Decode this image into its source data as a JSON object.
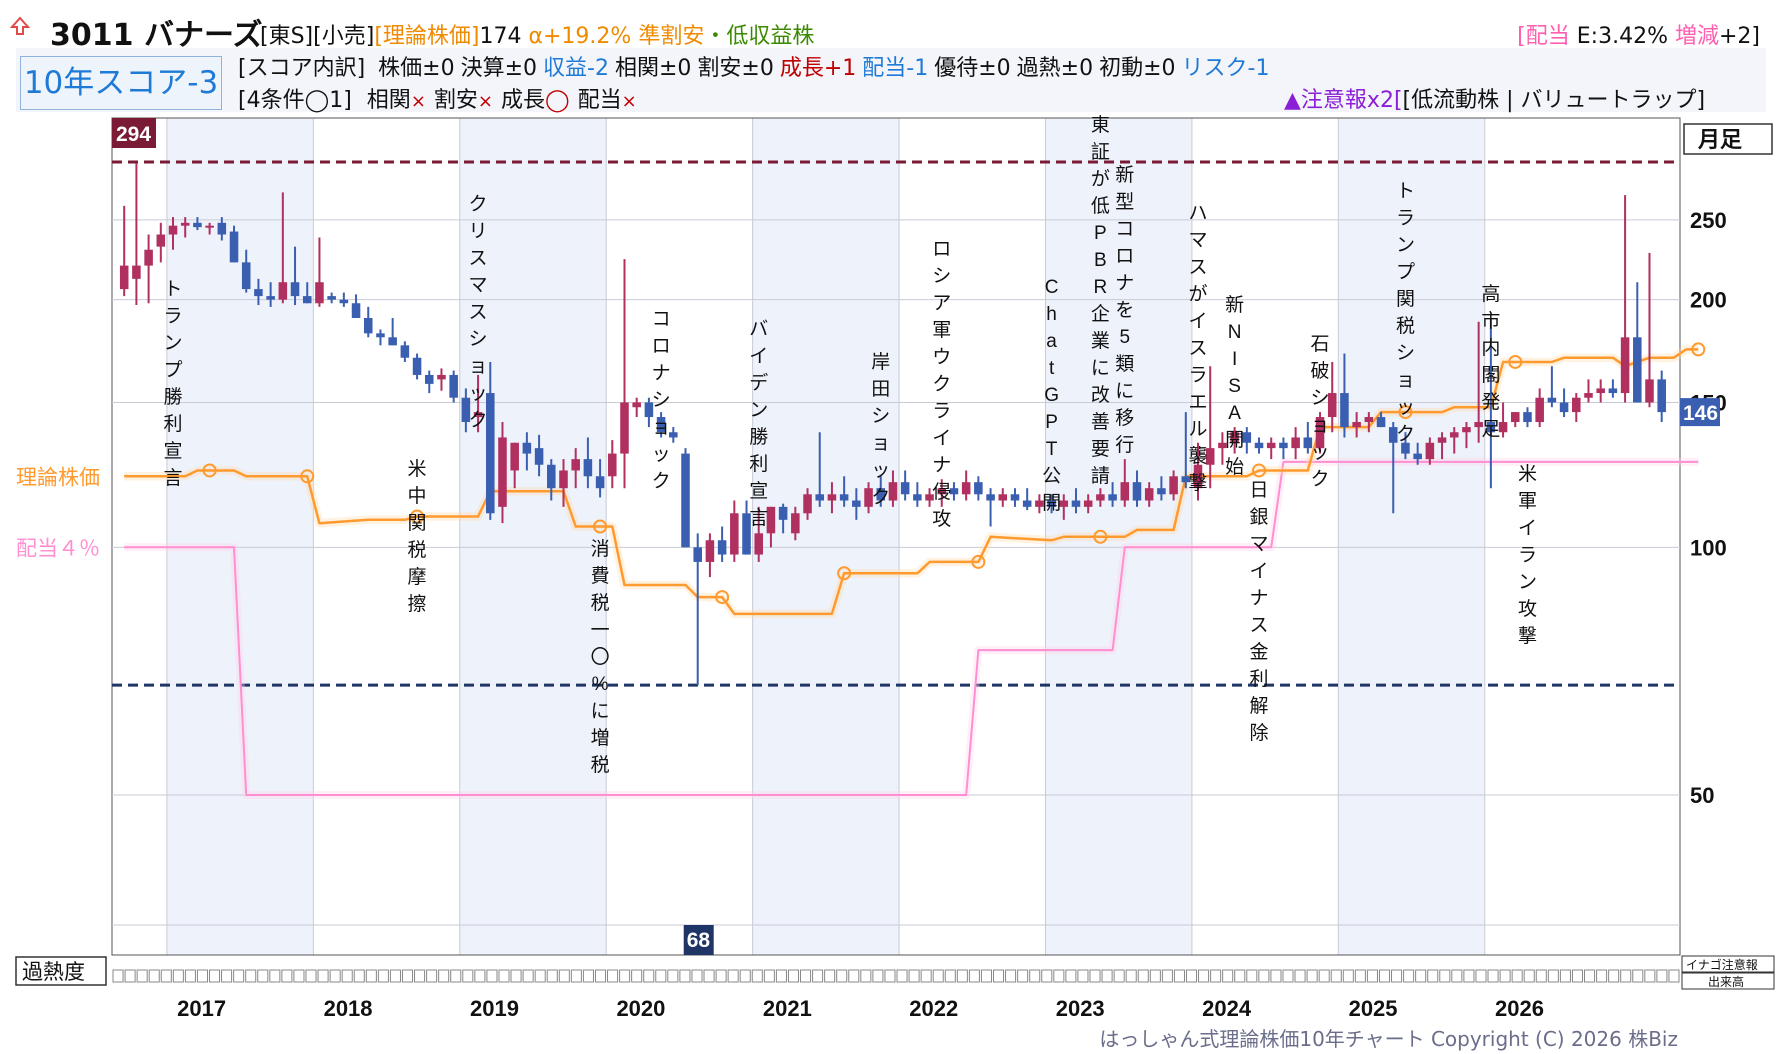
{
  "header": {
    "up_icon": "up-arrow-icon",
    "code_name": "3011 バナーズ",
    "market_tags": "[東S][小売]",
    "theory_label": "[理論株価]",
    "theory_value": "174",
    "alpha": "α+19.2%",
    "valuation_tag": "準割安",
    "profit_tag": "・低収益株",
    "dividend_label": "[配当",
    "dividend_value": "E:3.42%",
    "change_label": "増減",
    "change_value": "+2]"
  },
  "score": {
    "label": "10年スコア-3",
    "breakdown_prefix": "[スコア内訳]",
    "items": [
      {
        "label": "株価±0",
        "color": "#111111"
      },
      {
        "label": "決算±0",
        "color": "#111111"
      },
      {
        "label": "収益-2",
        "color": "#1f7ad6"
      },
      {
        "label": "相関±0",
        "color": "#111111"
      },
      {
        "label": "割安±0",
        "color": "#111111"
      },
      {
        "label": "成長+1",
        "color": "#c00000"
      },
      {
        "label": "配当-1",
        "color": "#1f7ad6"
      },
      {
        "label": "優待±0",
        "color": "#111111"
      },
      {
        "label": "過熱±0",
        "color": "#111111"
      },
      {
        "label": "初動±0",
        "color": "#111111"
      },
      {
        "label": "リスク-1",
        "color": "#1f7ad6"
      }
    ],
    "conditions_prefix": "[4条件◯1]",
    "conditions": [
      {
        "name": "相関",
        "mark": "×"
      },
      {
        "name": "割安",
        "mark": "×"
      },
      {
        "name": "成長",
        "mark": "◯"
      },
      {
        "name": "配当",
        "mark": "×"
      }
    ],
    "warning_label": "▲注意報x2",
    "warning_detail": "[低流動株 | バリュートラップ]"
  },
  "colors": {
    "up": "#b03060",
    "down": "#3a5fb0",
    "theory": "#ff9a2e",
    "dividend": "#ff8fd0",
    "band": "#eef2fb",
    "max_line": "#7a1a35",
    "min_line": "#1f3566"
  },
  "chart_data": {
    "type": "candlestick",
    "period": "月足",
    "x_axis": [
      "2017",
      "2018",
      "2019",
      "2020",
      "2021",
      "2022",
      "2023",
      "2024",
      "2025",
      "2026"
    ],
    "y_ticks": [
      50,
      100,
      150,
      200,
      250
    ],
    "y_log": true,
    "ylim": [
      50,
      294
    ],
    "max_marker": 294,
    "min_marker": 68,
    "last_price": 146,
    "left_labels": {
      "theory": "理論株価",
      "dividend": "配当４％"
    },
    "bottom_labels": {
      "overheat": "過熱度",
      "inago": "イナゴ注意報",
      "volume": "出来高"
    },
    "candles": [
      {
        "o": 206,
        "h": 260,
        "l": 202,
        "c": 220
      },
      {
        "o": 212,
        "h": 293,
        "l": 197,
        "c": 220
      },
      {
        "o": 220,
        "h": 240,
        "l": 198,
        "c": 230
      },
      {
        "o": 232,
        "h": 248,
        "l": 222,
        "c": 240
      },
      {
        "o": 240,
        "h": 252,
        "l": 230,
        "c": 246
      },
      {
        "o": 246,
        "h": 252,
        "l": 238,
        "c": 248
      },
      {
        "o": 248,
        "h": 252,
        "l": 243,
        "c": 245
      },
      {
        "o": 245,
        "h": 248,
        "l": 240,
        "c": 246
      },
      {
        "o": 248,
        "h": 252,
        "l": 236,
        "c": 240
      },
      {
        "o": 242,
        "h": 246,
        "l": 222,
        "c": 222
      },
      {
        "o": 222,
        "h": 230,
        "l": 204,
        "c": 206
      },
      {
        "o": 206,
        "h": 212,
        "l": 197,
        "c": 202
      },
      {
        "o": 202,
        "h": 210,
        "l": 196,
        "c": 200
      },
      {
        "o": 200,
        "h": 270,
        "l": 198,
        "c": 210
      },
      {
        "o": 210,
        "h": 232,
        "l": 197,
        "c": 202
      },
      {
        "o": 202,
        "h": 210,
        "l": 198,
        "c": 198
      },
      {
        "o": 198,
        "h": 238,
        "l": 196,
        "c": 210
      },
      {
        "o": 202,
        "h": 204,
        "l": 198,
        "c": 200
      },
      {
        "o": 200,
        "h": 204,
        "l": 196,
        "c": 198
      },
      {
        "o": 198,
        "h": 203,
        "l": 190,
        "c": 190
      },
      {
        "o": 190,
        "h": 196,
        "l": 180,
        "c": 182
      },
      {
        "o": 182,
        "h": 184,
        "l": 176,
        "c": 180
      },
      {
        "o": 180,
        "h": 190,
        "l": 176,
        "c": 176
      },
      {
        "o": 176,
        "h": 178,
        "l": 168,
        "c": 170
      },
      {
        "o": 170,
        "h": 172,
        "l": 160,
        "c": 162
      },
      {
        "o": 162,
        "h": 164,
        "l": 154,
        "c": 158
      },
      {
        "o": 160,
        "h": 165,
        "l": 155,
        "c": 162
      },
      {
        "o": 162,
        "h": 164,
        "l": 150,
        "c": 152
      },
      {
        "o": 152,
        "h": 156,
        "l": 138,
        "c": 142
      },
      {
        "o": 144,
        "h": 162,
        "l": 138,
        "c": 146
      },
      {
        "o": 154,
        "h": 168,
        "l": 108,
        "c": 110
      },
      {
        "o": 112,
        "h": 142,
        "l": 107,
        "c": 136
      },
      {
        "o": 124,
        "h": 134,
        "l": 118,
        "c": 134
      },
      {
        "o": 134,
        "h": 138,
        "l": 124,
        "c": 130
      },
      {
        "o": 132,
        "h": 137,
        "l": 122,
        "c": 126
      },
      {
        "o": 126,
        "h": 128,
        "l": 114,
        "c": 118
      },
      {
        "o": 118,
        "h": 128,
        "l": 112,
        "c": 124
      },
      {
        "o": 124,
        "h": 132,
        "l": 118,
        "c": 128
      },
      {
        "o": 128,
        "h": 136,
        "l": 118,
        "c": 122
      },
      {
        "o": 122,
        "h": 128,
        "l": 115,
        "c": 118
      },
      {
        "o": 122,
        "h": 135,
        "l": 118,
        "c": 130
      },
      {
        "o": 130,
        "h": 224,
        "l": 118,
        "c": 150
      },
      {
        "o": 148,
        "h": 152,
        "l": 144,
        "c": 150
      },
      {
        "o": 150,
        "h": 152,
        "l": 140,
        "c": 144
      },
      {
        "o": 144,
        "h": 146,
        "l": 136,
        "c": 138
      },
      {
        "o": 138,
        "h": 140,
        "l": 134,
        "c": 136
      },
      {
        "o": 130,
        "h": 132,
        "l": 100,
        "c": 100
      },
      {
        "o": 100,
        "h": 104,
        "l": 68,
        "c": 96
      },
      {
        "o": 96,
        "h": 104,
        "l": 92,
        "c": 102
      },
      {
        "o": 102,
        "h": 106,
        "l": 96,
        "c": 98
      },
      {
        "o": 98,
        "h": 114,
        "l": 96,
        "c": 110
      },
      {
        "o": 110,
        "h": 114,
        "l": 98,
        "c": 98
      },
      {
        "o": 98,
        "h": 112,
        "l": 96,
        "c": 104
      },
      {
        "o": 104,
        "h": 112,
        "l": 100,
        "c": 112
      },
      {
        "o": 112,
        "h": 113,
        "l": 104,
        "c": 108
      },
      {
        "o": 104,
        "h": 112,
        "l": 102,
        "c": 110
      },
      {
        "o": 110,
        "h": 118,
        "l": 108,
        "c": 116
      },
      {
        "o": 116,
        "h": 138,
        "l": 112,
        "c": 114
      },
      {
        "o": 114,
        "h": 120,
        "l": 110,
        "c": 116
      },
      {
        "o": 116,
        "h": 122,
        "l": 112,
        "c": 114
      },
      {
        "o": 114,
        "h": 118,
        "l": 108,
        "c": 112
      },
      {
        "o": 112,
        "h": 120,
        "l": 110,
        "c": 118
      },
      {
        "o": 118,
        "h": 122,
        "l": 112,
        "c": 114
      },
      {
        "o": 114,
        "h": 124,
        "l": 112,
        "c": 120
      },
      {
        "o": 120,
        "h": 124,
        "l": 114,
        "c": 116
      },
      {
        "o": 116,
        "h": 120,
        "l": 112,
        "c": 114
      },
      {
        "o": 114,
        "h": 118,
        "l": 112,
        "c": 116
      },
      {
        "o": 116,
        "h": 121,
        "l": 112,
        "c": 118
      },
      {
        "o": 118,
        "h": 120,
        "l": 114,
        "c": 116
      },
      {
        "o": 116,
        "h": 124,
        "l": 114,
        "c": 120
      },
      {
        "o": 120,
        "h": 122,
        "l": 114,
        "c": 116
      },
      {
        "o": 116,
        "h": 118,
        "l": 106,
        "c": 114
      },
      {
        "o": 114,
        "h": 118,
        "l": 112,
        "c": 116
      },
      {
        "o": 116,
        "h": 118,
        "l": 112,
        "c": 114
      },
      {
        "o": 114,
        "h": 118,
        "l": 111,
        "c": 112
      },
      {
        "o": 112,
        "h": 116,
        "l": 110,
        "c": 114
      },
      {
        "o": 114,
        "h": 116,
        "l": 110,
        "c": 112
      },
      {
        "o": 112,
        "h": 116,
        "l": 108,
        "c": 114
      },
      {
        "o": 114,
        "h": 118,
        "l": 110,
        "c": 112
      },
      {
        "o": 112,
        "h": 116,
        "l": 110,
        "c": 114
      },
      {
        "o": 114,
        "h": 118,
        "l": 112,
        "c": 116
      },
      {
        "o": 116,
        "h": 120,
        "l": 112,
        "c": 114
      },
      {
        "o": 114,
        "h": 128,
        "l": 112,
        "c": 120
      },
      {
        "o": 120,
        "h": 124,
        "l": 112,
        "c": 114
      },
      {
        "o": 114,
        "h": 120,
        "l": 112,
        "c": 118
      },
      {
        "o": 118,
        "h": 122,
        "l": 114,
        "c": 116
      },
      {
        "o": 116,
        "h": 124,
        "l": 114,
        "c": 122
      },
      {
        "o": 122,
        "h": 146,
        "l": 118,
        "c": 120
      },
      {
        "o": 118,
        "h": 134,
        "l": 114,
        "c": 126
      },
      {
        "o": 126,
        "h": 166,
        "l": 118,
        "c": 132
      },
      {
        "o": 132,
        "h": 138,
        "l": 126,
        "c": 134
      },
      {
        "o": 134,
        "h": 140,
        "l": 130,
        "c": 138
      },
      {
        "o": 138,
        "h": 140,
        "l": 130,
        "c": 134
      },
      {
        "o": 134,
        "h": 136,
        "l": 130,
        "c": 132
      },
      {
        "o": 132,
        "h": 136,
        "l": 128,
        "c": 134
      },
      {
        "o": 134,
        "h": 136,
        "l": 128,
        "c": 132
      },
      {
        "o": 132,
        "h": 140,
        "l": 128,
        "c": 136
      },
      {
        "o": 136,
        "h": 142,
        "l": 130,
        "c": 132
      },
      {
        "o": 132,
        "h": 146,
        "l": 130,
        "c": 144
      },
      {
        "o": 144,
        "h": 168,
        "l": 138,
        "c": 154
      },
      {
        "o": 154,
        "h": 172,
        "l": 136,
        "c": 140
      },
      {
        "o": 140,
        "h": 146,
        "l": 136,
        "c": 142
      },
      {
        "o": 142,
        "h": 146,
        "l": 138,
        "c": 144
      },
      {
        "o": 144,
        "h": 146,
        "l": 140,
        "c": 140
      },
      {
        "o": 140,
        "h": 142,
        "l": 110,
        "c": 134
      },
      {
        "o": 134,
        "h": 138,
        "l": 128,
        "c": 130
      },
      {
        "o": 130,
        "h": 134,
        "l": 126,
        "c": 128
      },
      {
        "o": 128,
        "h": 136,
        "l": 126,
        "c": 134
      },
      {
        "o": 134,
        "h": 138,
        "l": 128,
        "c": 136
      },
      {
        "o": 136,
        "h": 140,
        "l": 130,
        "c": 138
      },
      {
        "o": 138,
        "h": 142,
        "l": 132,
        "c": 140
      },
      {
        "o": 140,
        "h": 188,
        "l": 134,
        "c": 142
      },
      {
        "o": 142,
        "h": 190,
        "l": 118,
        "c": 138
      },
      {
        "o": 138,
        "h": 150,
        "l": 136,
        "c": 142
      },
      {
        "o": 142,
        "h": 146,
        "l": 140,
        "c": 146
      },
      {
        "o": 146,
        "h": 148,
        "l": 140,
        "c": 142
      },
      {
        "o": 142,
        "h": 156,
        "l": 140,
        "c": 152
      },
      {
        "o": 152,
        "h": 166,
        "l": 148,
        "c": 150
      },
      {
        "o": 150,
        "h": 156,
        "l": 144,
        "c": 146
      },
      {
        "o": 146,
        "h": 154,
        "l": 142,
        "c": 152
      },
      {
        "o": 152,
        "h": 160,
        "l": 150,
        "c": 154
      },
      {
        "o": 154,
        "h": 160,
        "l": 150,
        "c": 156
      },
      {
        "o": 156,
        "h": 160,
        "l": 152,
        "c": 154
      },
      {
        "o": 154,
        "h": 268,
        "l": 150,
        "c": 180
      },
      {
        "o": 180,
        "h": 210,
        "l": 150,
        "c": 150
      },
      {
        "o": 150,
        "h": 228,
        "l": 148,
        "c": 160
      },
      {
        "o": 160,
        "h": 164,
        "l": 142,
        "c": 146
      }
    ],
    "theory_line": [
      {
        "x": 0,
        "y": 122
      },
      {
        "x": 5,
        "y": 122
      },
      {
        "x": 6,
        "y": 124
      },
      {
        "x": 9,
        "y": 124
      },
      {
        "x": 10,
        "y": 122
      },
      {
        "x": 15,
        "y": 122
      },
      {
        "x": 16,
        "y": 107
      },
      {
        "x": 20,
        "y": 108
      },
      {
        "x": 23,
        "y": 108
      },
      {
        "x": 24,
        "y": 109
      },
      {
        "x": 29,
        "y": 109
      },
      {
        "x": 30,
        "y": 117
      },
      {
        "x": 36,
        "y": 117
      },
      {
        "x": 37,
        "y": 106
      },
      {
        "x": 40,
        "y": 106
      },
      {
        "x": 41,
        "y": 90
      },
      {
        "x": 46,
        "y": 90
      },
      {
        "x": 47,
        "y": 87
      },
      {
        "x": 49,
        "y": 87
      },
      {
        "x": 50,
        "y": 83
      },
      {
        "x": 58,
        "y": 83
      },
      {
        "x": 59,
        "y": 93
      },
      {
        "x": 65,
        "y": 93
      },
      {
        "x": 66,
        "y": 96
      },
      {
        "x": 70,
        "y": 96
      },
      {
        "x": 71,
        "y": 103
      },
      {
        "x": 76,
        "y": 102
      },
      {
        "x": 77,
        "y": 103
      },
      {
        "x": 82,
        "y": 103
      },
      {
        "x": 83,
        "y": 105
      },
      {
        "x": 86,
        "y": 105
      },
      {
        "x": 87,
        "y": 122
      },
      {
        "x": 92,
        "y": 122
      },
      {
        "x": 93,
        "y": 124
      },
      {
        "x": 97,
        "y": 124
      },
      {
        "x": 98,
        "y": 140
      },
      {
        "x": 102,
        "y": 140
      },
      {
        "x": 103,
        "y": 146
      },
      {
        "x": 108,
        "y": 146
      },
      {
        "x": 109,
        "y": 148
      },
      {
        "x": 112,
        "y": 148
      },
      {
        "x": 113,
        "y": 168
      },
      {
        "x": 117,
        "y": 168
      },
      {
        "x": 118,
        "y": 170
      },
      {
        "x": 122,
        "y": 170
      },
      {
        "x": 123,
        "y": 166
      },
      {
        "x": 125,
        "y": 170
      },
      {
        "x": 127,
        "y": 170
      },
      {
        "x": 128,
        "y": 174
      },
      {
        "x": 129,
        "y": 174
      }
    ],
    "theory_markers": [
      7,
      15,
      24,
      39,
      49,
      59,
      70,
      80,
      93,
      105,
      114,
      129
    ],
    "dividend_line": [
      {
        "x": 0,
        "y": 100
      },
      {
        "x": 9,
        "y": 100
      },
      {
        "x": 10,
        "y": 50
      },
      {
        "x": 69,
        "y": 50
      },
      {
        "x": 70,
        "y": 75
      },
      {
        "x": 81,
        "y": 75
      },
      {
        "x": 82,
        "y": 100
      },
      {
        "x": 94,
        "y": 100
      },
      {
        "x": 95,
        "y": 127
      },
      {
        "x": 129,
        "y": 127
      }
    ],
    "events": [
      {
        "label": "トランプ勝利宣言",
        "idx": 4,
        "y": 295
      },
      {
        "label": "米中関税摩擦",
        "idx": 24,
        "y": 475
      },
      {
        "label": "クリスマスショック",
        "idx": 29,
        "y": 210
      },
      {
        "label": "消費税一〇%に増税",
        "idx": 39,
        "y": 555
      },
      {
        "label": "コロナショック",
        "idx": 44,
        "y": 325
      },
      {
        "label": "バイデン勝利宣言",
        "idx": 52,
        "y": 335
      },
      {
        "label": "岸田ショック",
        "idx": 62,
        "y": 368
      },
      {
        "label": "ロシア軍ウクライナ侵攻",
        "idx": 67,
        "y": 255
      },
      {
        "label": "ChatGPT公開",
        "idx": 76,
        "y": 293
      },
      {
        "label": "東証が低PBR企業に改善要請",
        "idx": 80,
        "y": 131
      },
      {
        "label": "新型コロナを5類に移行",
        "idx": 82,
        "y": 181
      },
      {
        "label": "ハマスがイスラエル襲撃",
        "idx": 88,
        "y": 219
      },
      {
        "label": "新NISA開始",
        "idx": 91,
        "y": 311
      },
      {
        "label": "日銀マイナス金利解除",
        "idx": 93,
        "y": 496
      },
      {
        "label": "石破ショック",
        "idx": 98,
        "y": 350
      },
      {
        "label": "トランプ関税ショック",
        "idx": 105,
        "y": 197
      },
      {
        "label": "高市内閣発足",
        "idx": 112,
        "y": 300
      },
      {
        "label": "米軍イラン攻撃",
        "idx": 115,
        "y": 480
      }
    ],
    "overheat_cells": 130
  },
  "footer": {
    "copyright": "はっしゃん式理論株価10年チャート Copyright (C) 2026 株Biz"
  }
}
